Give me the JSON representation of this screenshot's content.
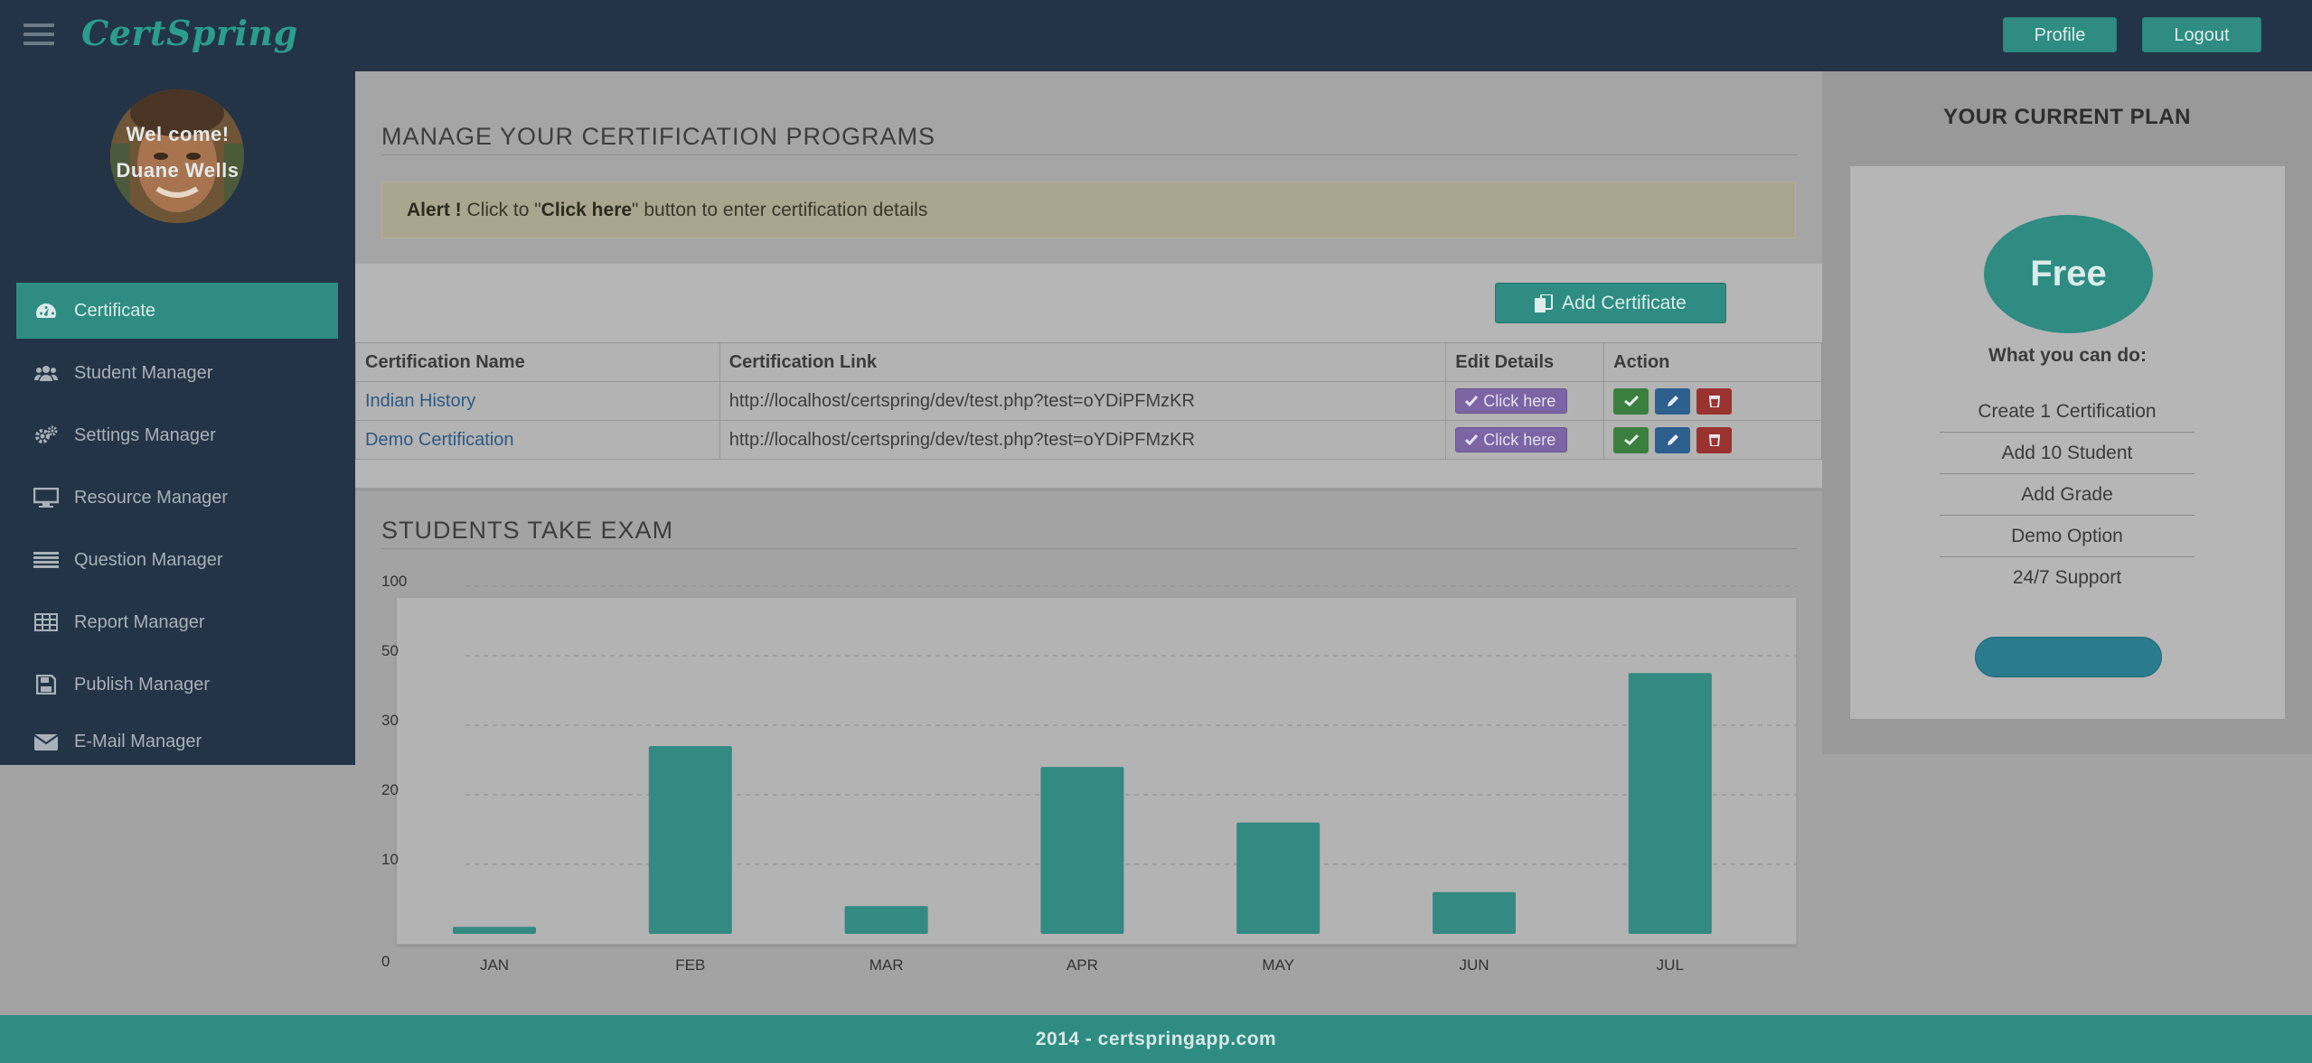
{
  "app": {
    "brand": "CertSpring"
  },
  "header": {
    "profile_label": "Profile",
    "logout_label": "Logout"
  },
  "sidebar": {
    "welcome": "Wel come!",
    "username": "Duane Wells",
    "items": [
      {
        "label": "Certificate",
        "icon": "dashboard-icon",
        "active": true
      },
      {
        "label": "Student Manager",
        "icon": "users-icon"
      },
      {
        "label": "Settings Manager",
        "icon": "cogs-icon"
      },
      {
        "label": "Resource Manager",
        "icon": "desktop-icon"
      },
      {
        "label": "Question Manager",
        "icon": "list-icon"
      },
      {
        "label": "Report Manager",
        "icon": "table-icon"
      },
      {
        "label": "Publish Manager",
        "icon": "save-icon"
      },
      {
        "label": "E-Mail Manager",
        "icon": "envelope-icon"
      }
    ]
  },
  "manage": {
    "title": "MANAGE YOUR CERTIFICATION PROGRAMS",
    "alert_strong": "Alert !",
    "alert_pre": " Click to \"",
    "alert_bold": "Click here",
    "alert_post": "\" button to enter certification details",
    "add_button": "Add Certificate"
  },
  "table": {
    "headers": [
      "Certification Name",
      "Certification Link",
      "Edit Details",
      "Action"
    ],
    "rows": [
      {
        "name": "Indian History",
        "link": "http://localhost/certspring/dev/test.php?test=oYDiPFMzKR",
        "edit": "Click here"
      },
      {
        "name": "Demo Certification",
        "link": "http://localhost/certspring/dev/test.php?test=oYDiPFMzKR",
        "edit": "Click here"
      }
    ]
  },
  "exam": {
    "title": "STUDENTS TAKE EXAM"
  },
  "chart_data": {
    "type": "bar",
    "title": "",
    "xlabel": "",
    "ylabel": "",
    "categories": [
      "JAN",
      "FEB",
      "MAR",
      "APR",
      "MAY",
      "JUN",
      "JUL"
    ],
    "values": [
      1,
      27,
      4,
      24,
      16,
      6,
      45
    ],
    "y_tick_labels": [
      "0",
      "10",
      "20",
      "30",
      "50",
      "100"
    ],
    "grid": true,
    "color": "#338a82"
  },
  "plan": {
    "title": "YOUR CURRENT PLAN",
    "name": "Free",
    "subtitle": "What you can do:",
    "features": [
      "Create 1 Certification",
      "Add 10 Student",
      "Add Grade",
      "Demo Option",
      "24/7 Support"
    ]
  },
  "footer": {
    "text": "2014 - certspringapp.com"
  }
}
